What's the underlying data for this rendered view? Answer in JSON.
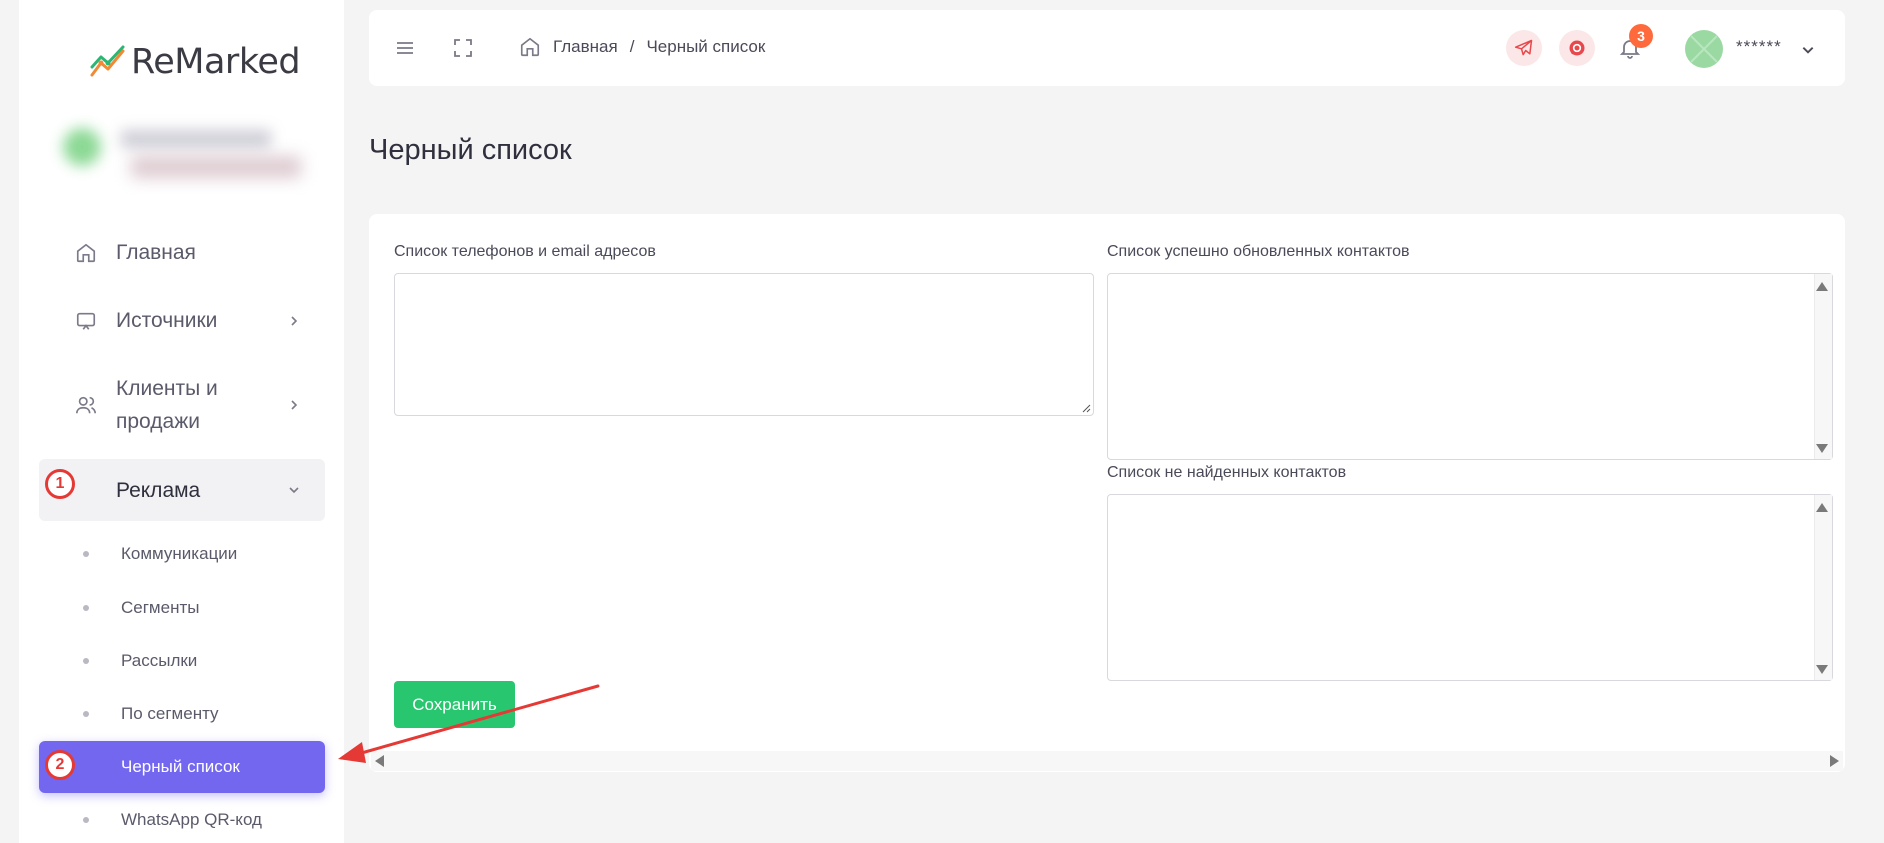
{
  "app": {
    "logo_text": "ReMarked",
    "accent_color": "#7367f0",
    "success_color": "#28c76f"
  },
  "sidebar": {
    "items": [
      {
        "label": "Главная",
        "icon": "home-icon"
      },
      {
        "label": "Источники",
        "icon": "monitor-icon"
      },
      {
        "label": "Клиенты и продажи",
        "icon": "users-icon"
      },
      {
        "label": "Реклама",
        "icon": "megaphone-icon"
      }
    ],
    "sub_items": [
      {
        "label": "Коммуникации"
      },
      {
        "label": "Сегменты"
      },
      {
        "label": "Рассылки"
      },
      {
        "label": "По сегменту"
      },
      {
        "label": "Черный список"
      },
      {
        "label": "WhatsApp QR-код"
      }
    ]
  },
  "annotations": {
    "step1": "1",
    "step2": "2"
  },
  "topbar": {
    "breadcrumb_home": "Главная",
    "breadcrumb_sep": "/",
    "breadcrumb_current": "Черный список",
    "notification_count": "3",
    "username": "******"
  },
  "page": {
    "title": "Черный список"
  },
  "form": {
    "contacts_label": "Список телефонов и email адресов",
    "contacts_value": "",
    "updated_label": "Список успешно обновленных контактов",
    "updated_value": "",
    "not_found_label": "Список не найденных контактов",
    "not_found_value": "",
    "save_label": "Сохранить"
  }
}
